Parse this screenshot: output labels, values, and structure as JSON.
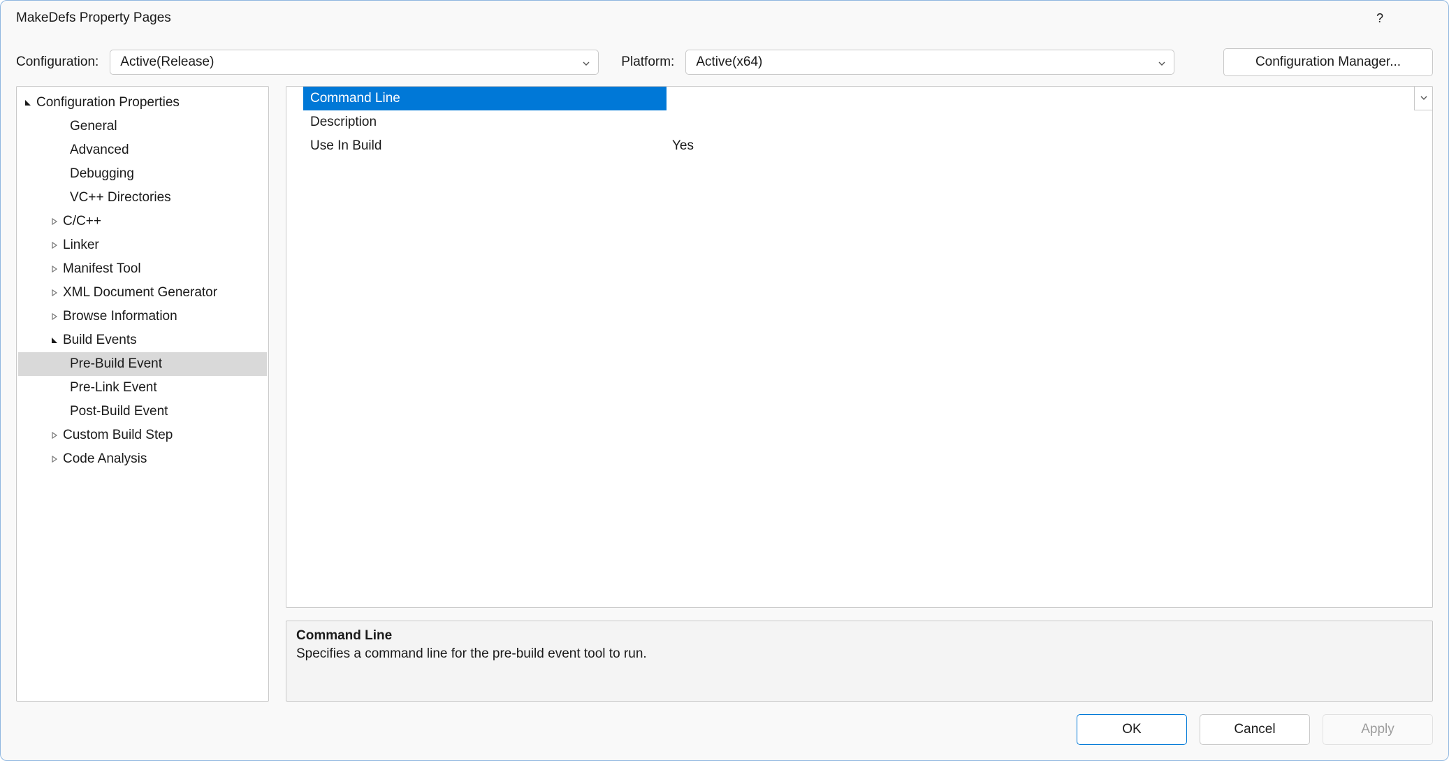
{
  "window": {
    "title": "MakeDefs Property Pages"
  },
  "top": {
    "configuration_label": "Configuration:",
    "configuration_value": "Active(Release)",
    "platform_label": "Platform:",
    "platform_value": "Active(x64)",
    "config_manager_label": "Configuration Manager..."
  },
  "tree": {
    "root": "Configuration Properties",
    "items": [
      {
        "label": "General",
        "indent": 2,
        "expander": "none"
      },
      {
        "label": "Advanced",
        "indent": 2,
        "expander": "none"
      },
      {
        "label": "Debugging",
        "indent": 2,
        "expander": "none"
      },
      {
        "label": "VC++ Directories",
        "indent": 2,
        "expander": "none"
      },
      {
        "label": "C/C++",
        "indent": 1,
        "expander": "closed"
      },
      {
        "label": "Linker",
        "indent": 1,
        "expander": "closed"
      },
      {
        "label": "Manifest Tool",
        "indent": 1,
        "expander": "closed"
      },
      {
        "label": "XML Document Generator",
        "indent": 1,
        "expander": "closed"
      },
      {
        "label": "Browse Information",
        "indent": 1,
        "expander": "closed"
      },
      {
        "label": "Build Events",
        "indent": 1,
        "expander": "open"
      },
      {
        "label": "Pre-Build Event",
        "indent": 2,
        "expander": "none",
        "selected": true
      },
      {
        "label": "Pre-Link Event",
        "indent": 2,
        "expander": "none"
      },
      {
        "label": "Post-Build Event",
        "indent": 2,
        "expander": "none"
      },
      {
        "label": "Custom Build Step",
        "indent": 1,
        "expander": "closed"
      },
      {
        "label": "Code Analysis",
        "indent": 1,
        "expander": "closed"
      }
    ]
  },
  "grid": {
    "rows": [
      {
        "name": "Command Line",
        "value": "",
        "selected": true
      },
      {
        "name": "Description",
        "value": ""
      },
      {
        "name": "Use In Build",
        "value": "Yes"
      }
    ]
  },
  "description": {
    "title": "Command Line",
    "body": "Specifies a command line for the pre-build event tool to run."
  },
  "buttons": {
    "ok": "OK",
    "cancel": "Cancel",
    "apply": "Apply"
  }
}
